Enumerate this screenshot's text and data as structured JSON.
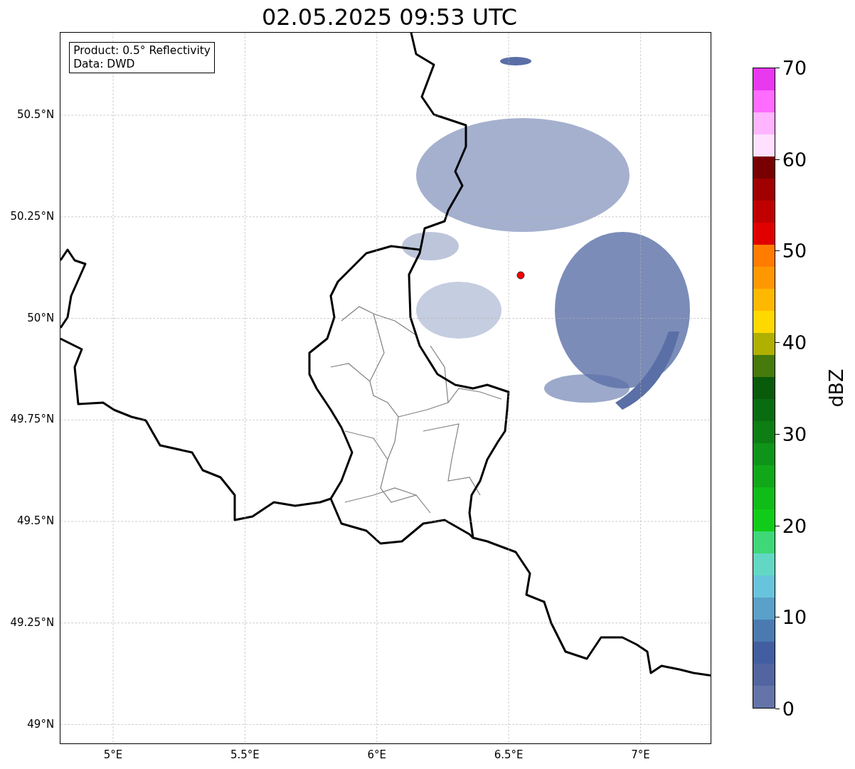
{
  "title": "02.05.2025 09:53 UTC",
  "info_box": {
    "lines": [
      "Product: 0.5° Reflectivity",
      "Data: DWD"
    ]
  },
  "map": {
    "xticks": [
      "5°E",
      "5.5°E",
      "6°E",
      "6.5°E",
      "7°E"
    ],
    "yticks": [
      "50.5°N",
      "50.25°N",
      "50°N",
      "49.75°N",
      "49.5°N",
      "49.25°N",
      "49°N"
    ]
  },
  "colorbar": {
    "label": "dBZ",
    "ticks": [
      "70",
      "60",
      "50",
      "40",
      "30",
      "20",
      "10",
      "0"
    ],
    "bins": [
      {
        "color": "#6474a8"
      },
      {
        "color": "#5265a0"
      },
      {
        "color": "#425ea0"
      },
      {
        "color": "#4a7ab0"
      },
      {
        "color": "#5aa0c8"
      },
      {
        "color": "#68c4dc"
      },
      {
        "color": "#62d8c4"
      },
      {
        "color": "#3ed878"
      },
      {
        "color": "#10cc18"
      },
      {
        "color": "#10bc18"
      },
      {
        "color": "#10a818"
      },
      {
        "color": "#0e9418"
      },
      {
        "color": "#0c7e14"
      },
      {
        "color": "#0a6c10"
      },
      {
        "color": "#0a5a0c"
      },
      {
        "color": "#467a0a"
      },
      {
        "color": "#b0b000"
      },
      {
        "color": "#ffd800"
      },
      {
        "color": "#ffb800"
      },
      {
        "color": "#ff9800"
      },
      {
        "color": "#ff7c00"
      },
      {
        "color": "#e00000"
      },
      {
        "color": "#c00000"
      },
      {
        "color": "#a00000"
      },
      {
        "color": "#780000"
      },
      {
        "color": "#ffe0ff"
      },
      {
        "color": "#ffb4ff"
      },
      {
        "color": "#ff6cff"
      },
      {
        "color": "#e838f0"
      }
    ]
  }
}
